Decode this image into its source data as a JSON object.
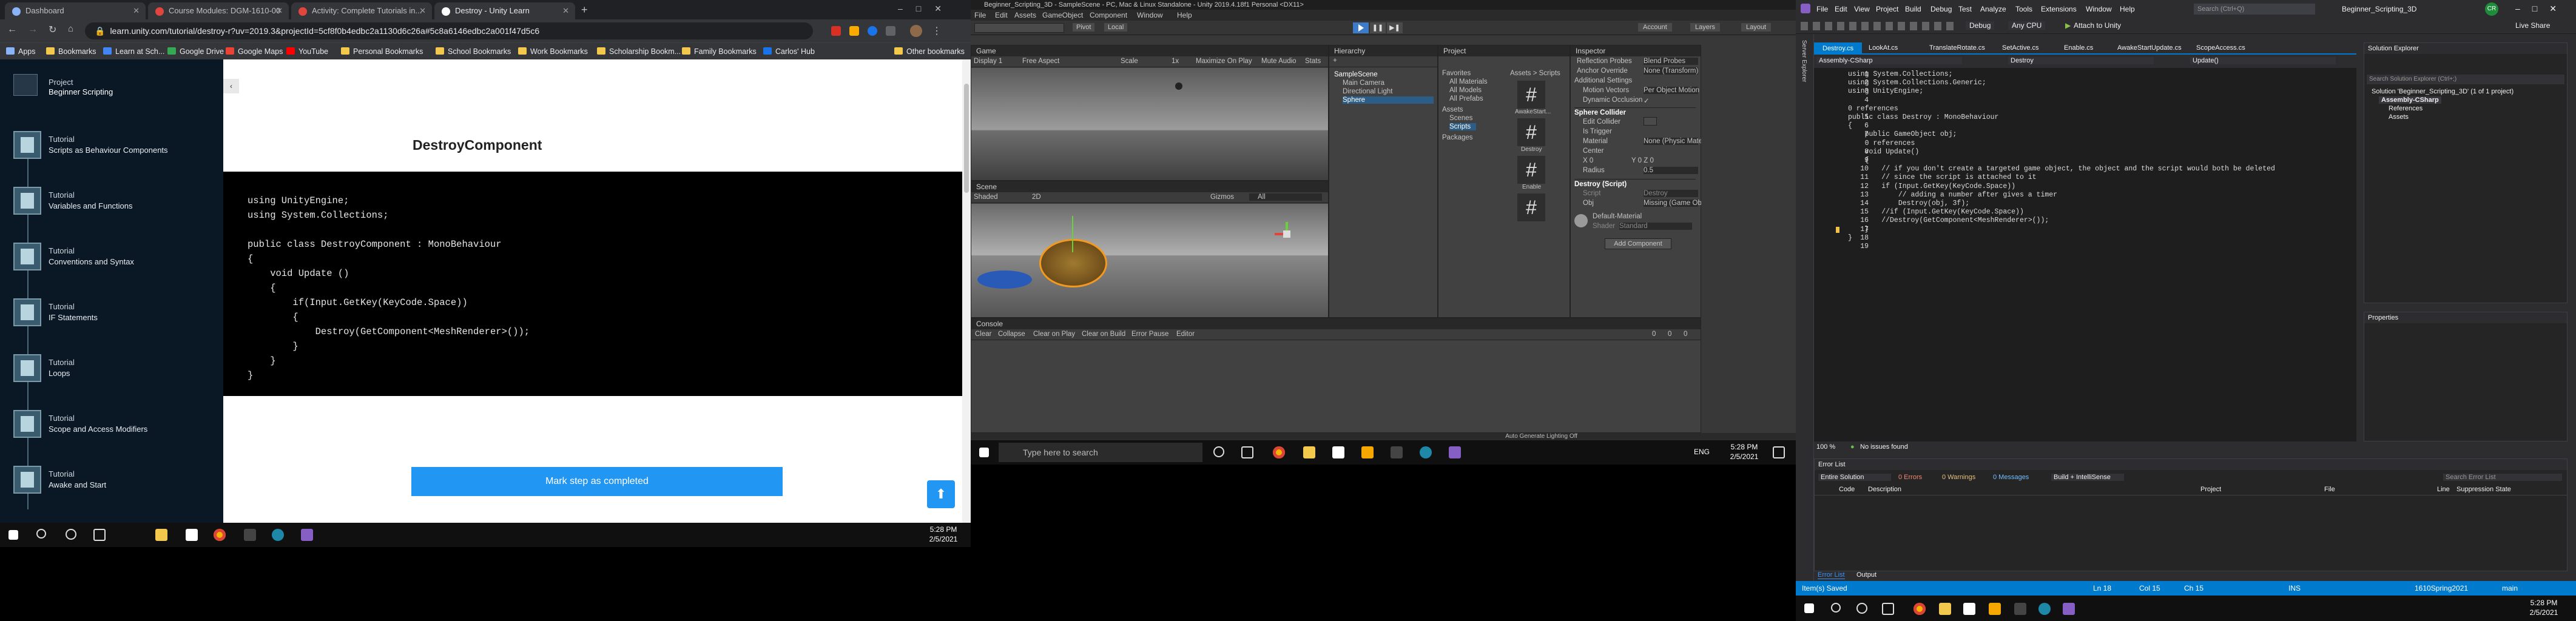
{
  "chrome": {
    "tabs": [
      {
        "title": "Dashboard"
      },
      {
        "title": "Course Modules: DGM-1610-00"
      },
      {
        "title": "Activity: Complete Tutorials in..."
      },
      {
        "title": "Destroy - Unity Learn"
      }
    ],
    "url": "learn.unity.com/tutorial/destroy-r?uv=2019.3&projectId=5cf8f0b4edbc2a1130d6c26a#5c8a6146edbc2a001f47d5c6",
    "bookmarks": [
      "Apps",
      "Bookmarks",
      "Learn at Sch...",
      "Google Drive",
      "Google Maps",
      "YouTube",
      "Personal Bookmarks",
      "School Bookmarks",
      "Work Bookmarks",
      "Scholarship Bookm...",
      "Family Bookmarks",
      "Carlos' Hub",
      "Other bookmarks"
    ]
  },
  "learn": {
    "project_label": "Project",
    "project_name": "Beginner Scripting",
    "steps": [
      {
        "kind": "Tutorial",
        "name": "Scripts as Behaviour Components"
      },
      {
        "kind": "Tutorial",
        "name": "Variables and Functions"
      },
      {
        "kind": "Tutorial",
        "name": "Conventions and Syntax"
      },
      {
        "kind": "Tutorial",
        "name": "IF Statements"
      },
      {
        "kind": "Tutorial",
        "name": "Loops"
      },
      {
        "kind": "Tutorial",
        "name": "Scope and Access Modifiers"
      },
      {
        "kind": "Tutorial",
        "name": "Awake and Start"
      }
    ],
    "heading": "DestroyComponent",
    "code": "using UnityEngine;\nusing System.Collections;\n\npublic class DestroyComponent : MonoBehaviour\n{\n    void Update ()\n    {\n        if(Input.GetKey(KeyCode.Space))\n        {\n            Destroy(GetComponent<MeshRenderer>());\n        }\n    }\n}",
    "mark_button": "Mark step as completed"
  },
  "taskbar_left": {
    "time": "5:28 PM",
    "date": "2/5/2021"
  },
  "unity": {
    "title": "Beginner_Scripting_3D - SampleScene - PC, Mac & Linux Standalone - Unity 2019.4.18f1 Personal <DX11>",
    "menu": [
      "File",
      "Edit",
      "Assets",
      "GameObject",
      "Component",
      "Window",
      "Help"
    ],
    "toolbar": {
      "pivot": "Pivot",
      "local": "Local",
      "account": "Account",
      "layers": "Layers",
      "layout": "Layout"
    },
    "game": {
      "tab": "Game",
      "display": "Display 1",
      "aspect": "Free Aspect",
      "scale": "Scale",
      "scale_val": "1x",
      "maximize": "Maximize On Play",
      "mute": "Mute Audio",
      "stats": "Stats"
    },
    "scene": {
      "tab": "Scene",
      "shading": "Shaded",
      "mode": "2D",
      "gizmos": "Gizmos",
      "search": "All"
    },
    "hierarchy": {
      "tab": "Hierarchy",
      "create": "+",
      "items": [
        "SampleScene",
        "Main Camera",
        "Directional Light",
        "Sphere"
      ]
    },
    "project": {
      "tab": "Project",
      "favorites": "Favorites",
      "fav_items": [
        "All Materials",
        "All Models",
        "All Prefabs"
      ],
      "assets": "Assets",
      "asset_items": [
        "Scenes",
        "Scripts"
      ],
      "packages": "Packages",
      "breadcrumb": "Assets > Scripts",
      "files": [
        "AwakeStart...",
        "Destroy",
        "Enable",
        "..."
      ]
    },
    "inspector": {
      "tab": "Inspector",
      "rows": [
        {
          "label": "Reflection Probes",
          "value": "Blend Probes"
        },
        {
          "label": "Anchor Override",
          "value": "None (Transform)"
        },
        {
          "label": "Additional Settings",
          "value": ""
        },
        {
          "label": "Motion Vectors",
          "value": "Per Object Motion"
        },
        {
          "label": "Dynamic Occlusion",
          "value": "✓"
        }
      ],
      "collider": "Sphere Collider",
      "collider_rows": [
        {
          "label": "Edit Collider",
          "value": ""
        },
        {
          "label": "Is Trigger",
          "value": ""
        },
        {
          "label": "Material",
          "value": "None (Physic Material)"
        },
        {
          "label": "Center",
          "value": ""
        },
        {
          "label": "X 0",
          "value": "Y 0   Z 0"
        },
        {
          "label": "Radius",
          "value": "0.5"
        }
      ],
      "script_comp": "Destroy (Script)",
      "script_rows": [
        {
          "label": "Script",
          "value": "Destroy"
        },
        {
          "label": "Obj",
          "value": "Missing (Game Object)"
        }
      ],
      "material": "Default-Material",
      "shader_label": "Shader",
      "shader": "Standard",
      "add_component": "Add Component"
    },
    "console": {
      "tab": "Console",
      "buttons": [
        "Clear",
        "Collapse",
        "Clear on Play",
        "Clear on Build",
        "Error Pause",
        "Editor"
      ],
      "counts": [
        "0",
        "0",
        "0"
      ]
    },
    "status": "Auto Generate Lighting Off"
  },
  "taskbar_mid": {
    "search": "Type here to search",
    "time": "5:28 PM",
    "date": "2/5/2021",
    "lang": "ENG"
  },
  "vs": {
    "menu": [
      "File",
      "Edit",
      "View",
      "Project",
      "Build",
      "Debug",
      "Test",
      "Analyze",
      "Tools",
      "Extensions",
      "Window",
      "Help"
    ],
    "search": "Search (Ctrl+Q)",
    "solution": "Beginner_Scripting_3D",
    "live_share": "Live Share",
    "config": "Debug",
    "platform": "Any CPU",
    "attach": "Attach to Unity",
    "tabs": [
      "Destroy.cs",
      "LookAt.cs",
      "TranslateRotate.cs",
      "SetActive.cs",
      "Enable.cs",
      "AwakeStartUpdate.cs",
      "ScopeAccess.cs"
    ],
    "nav": [
      "Assembly-CSharp",
      "Destroy",
      "Update()"
    ],
    "code": "using System.Collections;\nusing System.Collections.Generic;\nusing UnityEngine;\n\n0 references\npublic class Destroy : MonoBehaviour\n{\n    public GameObject obj;\n    0 references\n    void Update()\n    {\n        // if you don't create a targeted game object, the object and the script would both be deleted\n        // since the script is attached to it\n        if (Input.GetKey(KeyCode.Space))\n            // adding a number after gives a timer\n            Destroy(obj, 3f);\n        //if (Input.GetKey(KeyCode.Space))\n        //Destroy(GetComponent<MeshRenderer>());\n    }\n}",
    "line_numbers": "1\n2\n3\n4\n\n5\n6\n7\n\n8\n9\n10\n11\n12\n13\n14\n15\n16\n17\n18\n19",
    "zoom": "100 %",
    "issues": "No issues found",
    "solution_explorer": {
      "title": "Solution Explorer",
      "search": "Search Solution Explorer (Ctrl+;)",
      "solution_line": "Solution 'Beginner_Scripting_3D' (1 of 1 project)",
      "items": [
        "Assembly-CSharp",
        "References",
        "Assets"
      ]
    },
    "properties": "Properties",
    "error_list": {
      "title": "Error List",
      "scope": "Entire Solution",
      "errors": "0 Errors",
      "warnings": "0 Warnings",
      "messages": "0 Messages",
      "build": "Build + IntelliSense",
      "search": "Search Error List",
      "cols": [
        "Code",
        "Description",
        "Project",
        "File",
        "Line",
        "Suppression State"
      ]
    },
    "bottom_tabs": [
      "Error List",
      "Output"
    ],
    "status": {
      "saved": "Item(s) Saved",
      "ln": "Ln 18",
      "col": "Col 15",
      "ch": "Ch 15",
      "ins": "INS",
      "branch": "main",
      "repo": "1610Spring2021"
    },
    "taskbar": {
      "time": "5:28 PM",
      "date": "2/5/2021"
    }
  }
}
